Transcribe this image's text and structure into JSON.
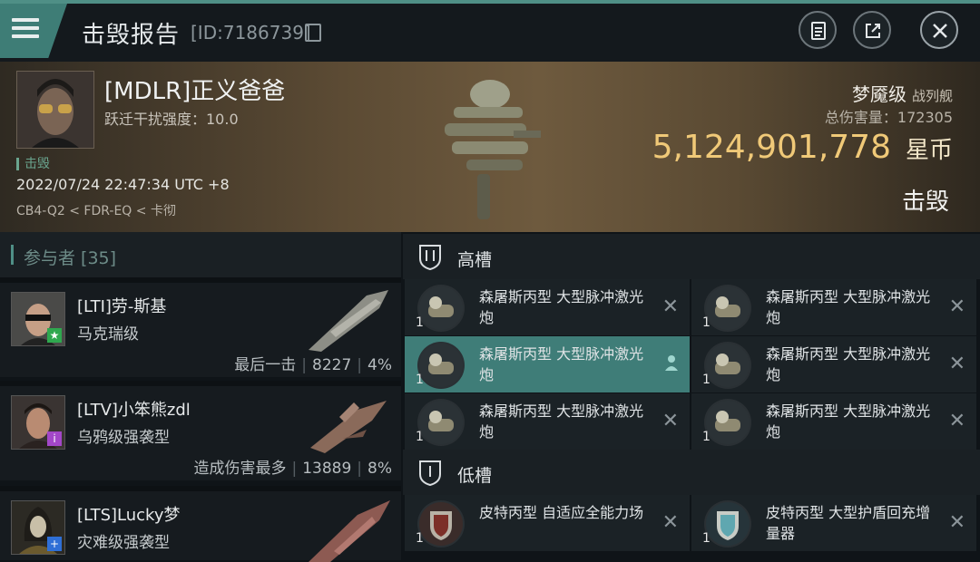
{
  "header": {
    "title": "击毁报告",
    "report_id": "[ID:7186739]",
    "icons": [
      "menu-icon",
      "copy-icon",
      "clipboard-icon",
      "share-icon",
      "close-icon"
    ]
  },
  "victim": {
    "name": "[MDLR]正义爸爸",
    "warp_disruption": "跃迁干扰强度：10.0",
    "kill_label": "击毁",
    "datetime": "2022/07/24 22:47:34 UTC +8",
    "location": "CB4-Q2 < FDR-EQ < 卡彻",
    "ship_name": "梦魇级",
    "ship_type": "战列舰",
    "total_damage_label": "总伤害量：",
    "total_damage": "172305",
    "value": "5,124,901,778",
    "value_unit": "星币",
    "status": "击毁"
  },
  "participants": {
    "title": "参与者 [35]",
    "items": [
      {
        "name": "[LTI]劳-斯基",
        "ship": "马克瑞级",
        "tag": "最后一击",
        "damage": "8227",
        "percent": "4%",
        "badge_color": "#2fa84f"
      },
      {
        "name": "[LTV]小笨熊zdl",
        "ship": "乌鸦级强袭型",
        "tag": "造成伤害最多",
        "damage": "13889",
        "percent": "8%",
        "badge_color": "#a347c8"
      },
      {
        "name": "[LTS]Lucky梦",
        "ship": "灾难级强袭型",
        "badge_color": "#2f6fd6"
      }
    ]
  },
  "slots": {
    "high": {
      "title": "高槽",
      "modules": [
        {
          "name": "森屠斯丙型 大型脉冲激光炮",
          "qty": "1",
          "icon": "laser-icon"
        },
        {
          "name": "森屠斯丙型 大型脉冲激光炮",
          "qty": "1",
          "icon": "laser-icon"
        },
        {
          "name": "森屠斯丙型 大型脉冲激光炮",
          "qty": "1",
          "icon": "laser-icon"
        },
        {
          "name": "森屠斯丙型 大型脉冲激光炮",
          "qty": "1",
          "icon": "laser-icon"
        },
        {
          "name": "森屠斯丙型 大型脉冲激光炮",
          "qty": "1",
          "icon": "laser-icon"
        },
        {
          "name": "森屠斯丙型 大型脉冲激光炮",
          "qty": "1",
          "icon": "laser-icon"
        }
      ]
    },
    "low": {
      "title": "低槽",
      "modules": [
        {
          "name": "皮特丙型 自适应全能力场",
          "qty": "1",
          "icon": "armor-hardener-icon"
        },
        {
          "name": "皮特丙型 大型护盾回充增量器",
          "qty": "1",
          "icon": "shield-recharger-icon"
        }
      ]
    }
  }
}
